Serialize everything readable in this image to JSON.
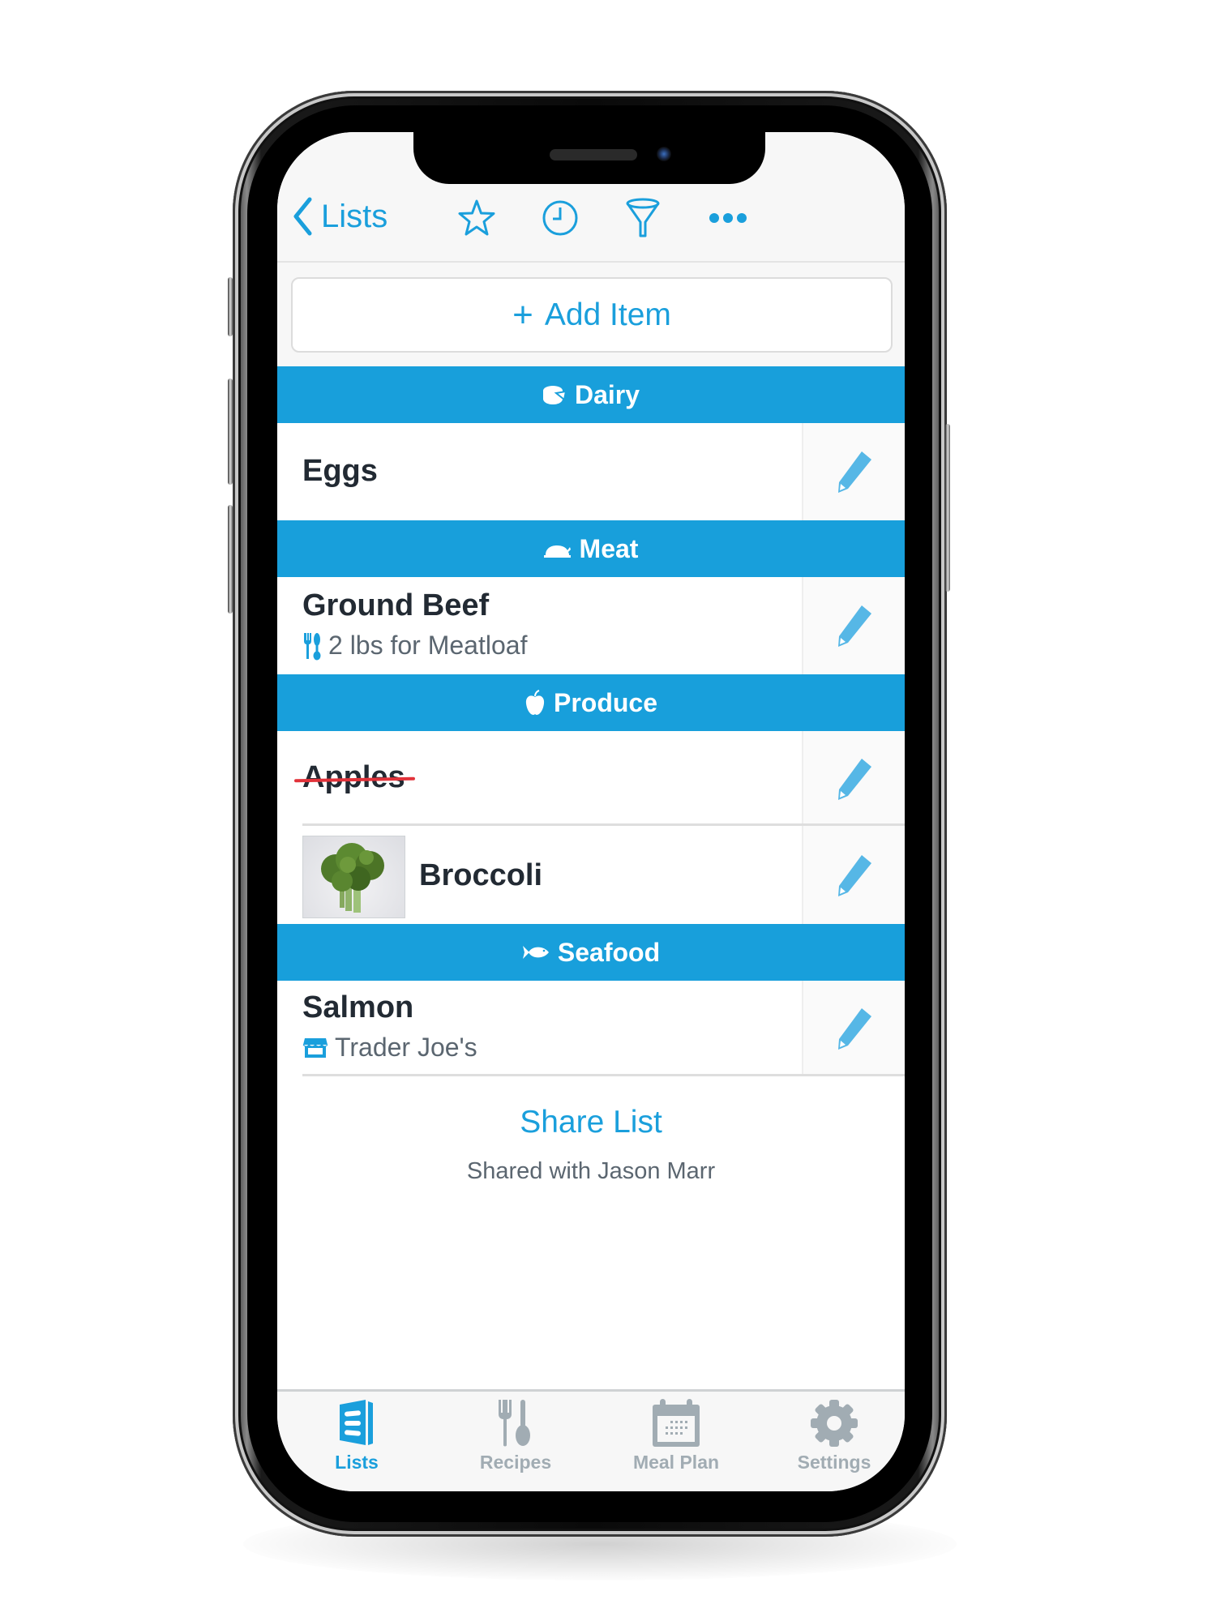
{
  "colors": {
    "accent": "#1a9fdc",
    "section_header": "#189fdb",
    "inactive_tab": "#a1acb3",
    "strike": "#e2323a"
  },
  "navbar": {
    "back_label": "Lists",
    "icons": [
      "star-icon",
      "clock-icon",
      "filter-icon",
      "more-icon"
    ]
  },
  "add_item": {
    "label": "Add Item",
    "icon": "plus-icon"
  },
  "sections": [
    {
      "name": "Dairy",
      "icon": "cheese-icon",
      "items": [
        {
          "title": "Eggs",
          "checked": false
        }
      ]
    },
    {
      "name": "Meat",
      "icon": "turkey-icon",
      "items": [
        {
          "title": "Ground Beef",
          "subtitle": "2 lbs for Meatloaf",
          "subtitle_icon": "utensils-icon",
          "checked": false
        }
      ]
    },
    {
      "name": "Produce",
      "icon": "apple-icon",
      "items": [
        {
          "title": "Apples",
          "checked": true
        },
        {
          "title": "Broccoli",
          "has_photo": true,
          "checked": false
        }
      ]
    },
    {
      "name": "Seafood",
      "icon": "fish-icon",
      "items": [
        {
          "title": "Salmon",
          "subtitle": "Trader Joe's",
          "subtitle_icon": "store-icon",
          "checked": false
        }
      ]
    }
  ],
  "share": {
    "link": "Share List",
    "shared_with": "Shared with Jason Marr"
  },
  "tabbar": {
    "tabs": [
      {
        "label": "Lists",
        "icon": "lists-icon",
        "active": true
      },
      {
        "label": "Recipes",
        "icon": "fork-spoon-icon",
        "active": false
      },
      {
        "label": "Meal Plan",
        "icon": "calendar-icon",
        "active": false
      },
      {
        "label": "Settings",
        "icon": "gear-icon",
        "active": false
      }
    ]
  }
}
